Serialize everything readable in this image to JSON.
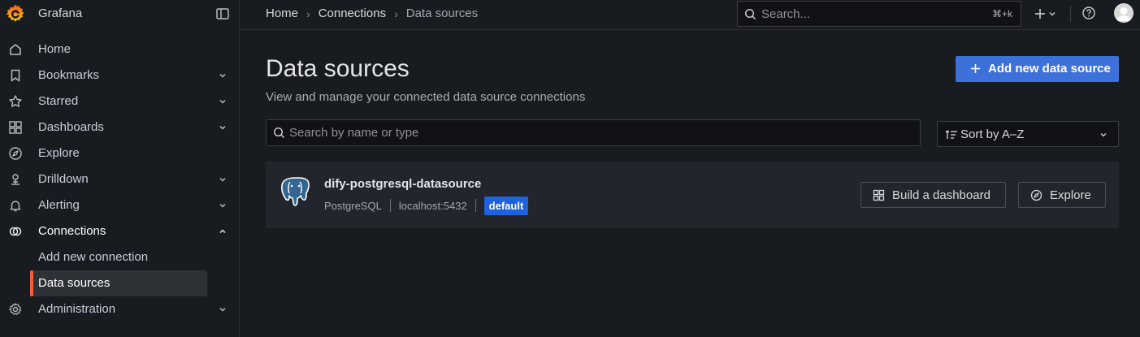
{
  "app": {
    "name": "Grafana"
  },
  "sidebar": {
    "items": [
      {
        "label": "Home",
        "icon": "home-icon",
        "expandable": false
      },
      {
        "label": "Bookmarks",
        "icon": "bookmark-icon",
        "expandable": true
      },
      {
        "label": "Starred",
        "icon": "star-icon",
        "expandable": true
      },
      {
        "label": "Dashboards",
        "icon": "dashboards-icon",
        "expandable": true
      },
      {
        "label": "Explore",
        "icon": "compass-icon",
        "expandable": false
      },
      {
        "label": "Drilldown",
        "icon": "drilldown-icon",
        "expandable": true
      },
      {
        "label": "Alerting",
        "icon": "bell-icon",
        "expandable": true
      },
      {
        "label": "Connections",
        "icon": "connections-icon",
        "expandable": true,
        "expanded": true
      },
      {
        "label": "Administration",
        "icon": "gear-icon",
        "expandable": true
      }
    ],
    "connections_children": [
      {
        "label": "Add new connection",
        "selected": false
      },
      {
        "label": "Data sources",
        "selected": true
      }
    ]
  },
  "breadcrumb": [
    {
      "label": "Home"
    },
    {
      "label": "Connections"
    },
    {
      "label": "Data sources"
    }
  ],
  "topbar": {
    "search_placeholder": "Search...",
    "search_shortcut": "⌘+k"
  },
  "main": {
    "title": "Data sources",
    "subtitle": "View and manage your connected data source connections",
    "add_button_label": "Add new data source",
    "filter_placeholder": "Search by name or type",
    "sort_value": "Sort by A–Z"
  },
  "datasources": [
    {
      "name": "dify-postgresql-datasource",
      "type": "PostgreSQL",
      "url": "localhost:5432",
      "badge": "default",
      "build_label": "Build a dashboard",
      "explore_label": "Explore"
    }
  ],
  "colors": {
    "background": "#181b1f",
    "primary": "#3d71d9",
    "accent": "#f55f3e",
    "badge": "#1f62e0",
    "card": "#22252b"
  }
}
